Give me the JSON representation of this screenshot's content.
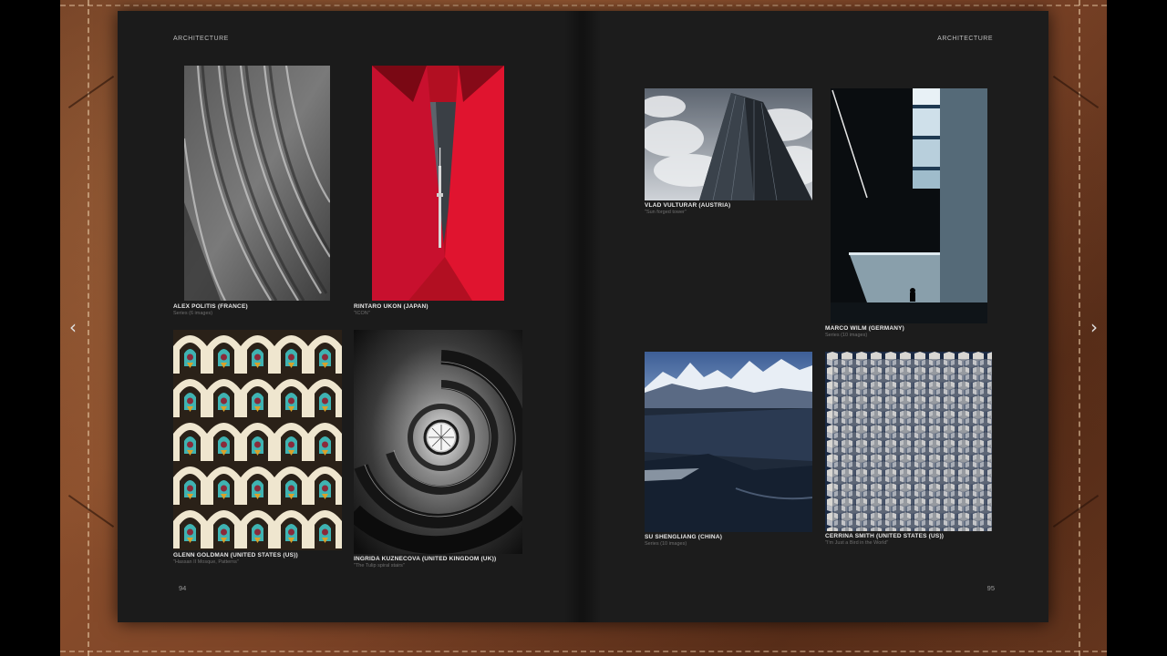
{
  "spread": {
    "left_page": {
      "header": "ARCHITECTURE",
      "page_number": "94",
      "photos": [
        {
          "photographer": "ALEX POLITIS (FRANCE)",
          "subtitle": "Series (6 images)"
        },
        {
          "photographer": "RINTARO UKON (JAPAN)",
          "subtitle": "\"ICON\""
        },
        {
          "photographer": "GLENN GOLDMAN (UNITED STATES (US))",
          "subtitle": "\"Hassan II Mosque, Patterns\""
        },
        {
          "photographer": "INGRIDA KUZNECOVA (UNITED KINGDOM (UK))",
          "subtitle": "\"The Tulip spiral stairs\""
        }
      ]
    },
    "right_page": {
      "header": "ARCHITECTURE",
      "page_number": "95",
      "photos": [
        {
          "photographer": "VLAD VULTURAR (AUSTRIA)",
          "subtitle": "\"Sun forged tower\""
        },
        {
          "photographer": "MARCO WILM (GERMANY)",
          "subtitle": "Series (10 images)"
        },
        {
          "photographer": "SU SHENGLIANG (CHINA)",
          "subtitle": "Series (10 images)"
        },
        {
          "photographer": "CERRINA SMITH (UNITED STATES (US))",
          "subtitle": "\"I'm Just a Bird in the World\""
        }
      ]
    }
  },
  "navigation": {
    "prev_glyph": "‹",
    "next_glyph": "›"
  },
  "colors": {
    "page_background": "#1b1b1b",
    "leather": "#7a4226",
    "caption_name": "#e8e8e8",
    "caption_sub": "#6f6f6f",
    "accent_red": "#c8102e"
  }
}
